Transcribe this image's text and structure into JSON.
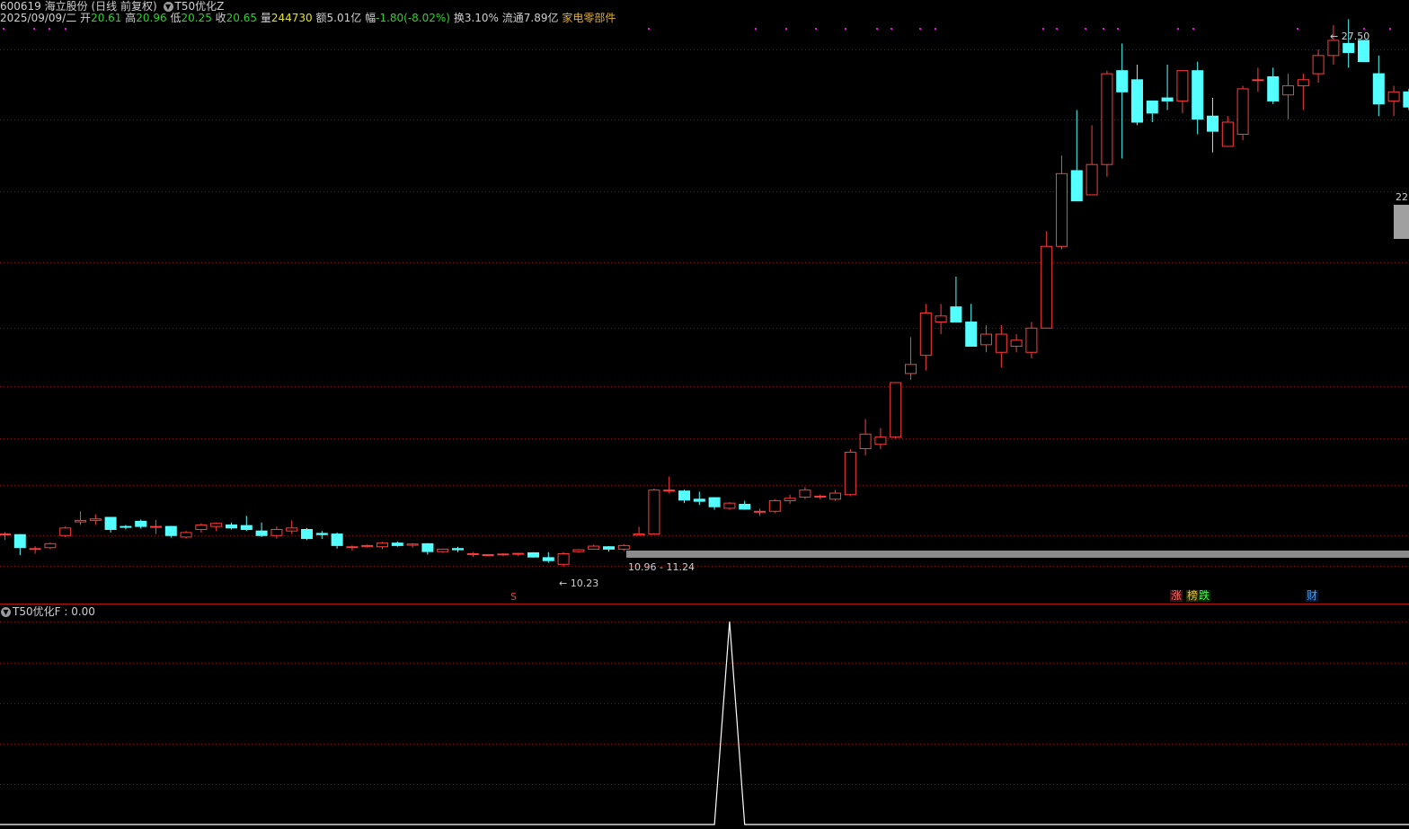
{
  "header": {
    "code": "600619",
    "name": "海立股份",
    "period": "(日线 前复权)",
    "indicator": "T50优化Z",
    "date": "2025/09/09/二",
    "open_label": "开",
    "open": "20.61",
    "high_label": "高",
    "high": "20.96",
    "low_label": "低",
    "low": "20.25",
    "close_label": "收",
    "close": "20.65",
    "vol_label": "量",
    "vol": "244730",
    "amount_label": "额",
    "amount": "5.01亿",
    "change_label": "幅",
    "change": "-1.80(-8.02%)",
    "turnover_label": "换",
    "turnover": "3.10%",
    "float_label": "流通",
    "float": "7.89亿",
    "sector": "家电零部件"
  },
  "annotations": {
    "high_mark": "27.50",
    "low_mark": "10.23",
    "range_label": "10.96 - 11.24",
    "right_price": "22",
    "s_marker": "S",
    "tag_zhang": "涨",
    "tag_bang": "榜",
    "tag_die": "跌",
    "tag_cai": "财"
  },
  "sub_panel": {
    "title": "T50优化F",
    "value_text": ": 0.00"
  },
  "colors": {
    "up": "#ff3c3c",
    "down": "#54ffff",
    "grid": "#7a1414",
    "line": "#ffffff",
    "band": "#8c8c8c",
    "dot": "#ff00ff"
  },
  "chart_data": {
    "type": "candlestick",
    "price_range": [
      9.0,
      28.1
    ],
    "candles": [
      [
        11.0,
        11.06,
        10.8,
        11.0
      ],
      [
        10.98,
        11.0,
        10.3,
        10.55
      ],
      [
        10.5,
        10.6,
        10.35,
        10.52
      ],
      [
        10.55,
        10.72,
        10.5,
        10.68
      ],
      [
        10.95,
        11.25,
        10.9,
        11.2
      ],
      [
        11.4,
        11.75,
        11.3,
        11.45
      ],
      [
        11.45,
        11.65,
        11.3,
        11.5
      ],
      [
        11.55,
        11.56,
        11.05,
        11.15
      ],
      [
        11.25,
        11.3,
        11.15,
        11.23
      ],
      [
        11.42,
        11.48,
        11.18,
        11.25
      ],
      [
        11.25,
        11.46,
        11.0,
        11.25
      ],
      [
        11.25,
        11.27,
        10.88,
        10.95
      ],
      [
        10.9,
        11.1,
        10.85,
        11.05
      ],
      [
        11.15,
        11.35,
        11.05,
        11.3
      ],
      [
        11.25,
        11.38,
        11.1,
        11.35
      ],
      [
        11.3,
        11.38,
        11.15,
        11.2
      ],
      [
        11.28,
        11.6,
        11.1,
        11.15
      ],
      [
        11.1,
        11.38,
        10.9,
        10.95
      ],
      [
        10.95,
        11.25,
        10.85,
        11.15
      ],
      [
        11.1,
        11.45,
        11.0,
        11.2
      ],
      [
        11.15,
        11.2,
        10.8,
        10.85
      ],
      [
        11.02,
        11.1,
        10.84,
        10.98
      ],
      [
        11.0,
        11.05,
        10.52,
        10.62
      ],
      [
        10.55,
        10.62,
        10.45,
        10.58
      ],
      [
        10.6,
        10.65,
        10.55,
        10.62
      ],
      [
        10.58,
        10.74,
        10.5,
        10.7
      ],
      [
        10.7,
        10.75,
        10.58,
        10.62
      ],
      [
        10.63,
        10.7,
        10.55,
        10.67
      ],
      [
        10.68,
        10.7,
        10.32,
        10.42
      ],
      [
        10.42,
        10.52,
        10.38,
        10.5
      ],
      [
        10.52,
        10.58,
        10.4,
        10.48
      ],
      [
        10.35,
        10.4,
        10.25,
        10.35
      ],
      [
        10.3,
        10.34,
        10.26,
        10.32
      ],
      [
        10.32,
        10.36,
        10.28,
        10.34
      ],
      [
        10.34,
        10.38,
        10.28,
        10.36
      ],
      [
        10.38,
        10.4,
        10.22,
        10.24
      ],
      [
        10.22,
        10.4,
        10.05,
        10.12
      ],
      [
        10.0,
        10.4,
        9.92,
        10.35
      ],
      [
        10.42,
        10.5,
        10.38,
        10.48
      ],
      [
        10.5,
        10.65,
        10.48,
        10.6
      ],
      [
        10.58,
        10.6,
        10.42,
        10.5
      ],
      [
        10.5,
        10.66,
        10.44,
        10.62
      ],
      [
        10.96,
        11.24,
        10.96,
        11.0
      ],
      [
        11.0,
        12.5,
        11.0,
        12.45
      ],
      [
        12.45,
        12.9,
        12.35,
        12.45
      ],
      [
        12.42,
        12.46,
        12.02,
        12.12
      ],
      [
        12.15,
        12.4,
        11.96,
        12.08
      ],
      [
        12.2,
        12.22,
        11.8,
        11.9
      ],
      [
        11.85,
        12.05,
        11.8,
        12.02
      ],
      [
        11.98,
        12.1,
        11.8,
        11.82
      ],
      [
        11.72,
        11.84,
        11.6,
        11.75
      ],
      [
        11.75,
        12.15,
        11.7,
        12.1
      ],
      [
        12.1,
        12.3,
        12.0,
        12.18
      ],
      [
        12.22,
        12.55,
        12.15,
        12.45
      ],
      [
        12.25,
        12.3,
        12.15,
        12.25
      ],
      [
        12.15,
        12.45,
        12.1,
        12.35
      ],
      [
        12.3,
        13.8,
        12.25,
        13.7
      ],
      [
        13.82,
        14.8,
        13.6,
        14.3
      ],
      [
        13.96,
        14.5,
        13.8,
        14.2
      ],
      [
        14.2,
        16.0,
        14.15,
        16.0
      ],
      [
        16.3,
        17.5,
        16.1,
        16.6
      ],
      [
        16.9,
        18.6,
        16.4,
        18.3
      ],
      [
        18.0,
        18.6,
        17.6,
        18.2
      ],
      [
        18.5,
        19.5,
        18.0,
        18.0
      ],
      [
        18.0,
        18.6,
        17.5,
        17.2
      ],
      [
        17.25,
        17.9,
        17.0,
        17.6
      ],
      [
        17.0,
        17.9,
        16.5,
        17.6
      ],
      [
        17.2,
        17.6,
        17.0,
        17.4
      ],
      [
        17.0,
        18.0,
        16.8,
        17.8
      ],
      [
        17.8,
        21.0,
        17.8,
        20.5
      ],
      [
        20.5,
        23.5,
        20.4,
        22.9
      ],
      [
        23.0,
        25.0,
        22.2,
        22.0
      ],
      [
        22.2,
        24.5,
        22.2,
        23.2
      ],
      [
        23.2,
        26.3,
        22.8,
        26.2
      ],
      [
        26.3,
        27.2,
        23.4,
        25.6
      ],
      [
        26.0,
        26.5,
        24.5,
        24.6
      ],
      [
        25.3,
        25.3,
        24.6,
        24.9
      ],
      [
        25.4,
        26.5,
        25.0,
        25.3
      ],
      [
        25.3,
        26.2,
        24.9,
        26.3
      ],
      [
        26.3,
        26.6,
        24.2,
        24.7
      ],
      [
        24.8,
        25.4,
        23.6,
        24.3
      ],
      [
        23.8,
        24.8,
        23.8,
        24.6
      ],
      [
        24.2,
        25.8,
        24.0,
        25.7
      ],
      [
        26.0,
        26.4,
        25.6,
        26.0
      ],
      [
        26.1,
        26.4,
        25.2,
        25.3
      ],
      [
        25.5,
        26.2,
        24.7,
        25.8
      ],
      [
        25.8,
        26.2,
        25.0,
        26.0
      ],
      [
        26.2,
        27.0,
        25.9,
        26.8
      ],
      [
        26.8,
        27.8,
        26.5,
        27.3
      ],
      [
        27.2,
        28.0,
        26.4,
        26.9
      ],
      [
        27.3,
        27.3,
        26.6,
        26.6
      ],
      [
        26.2,
        26.8,
        24.8,
        25.2
      ],
      [
        25.3,
        25.8,
        24.8,
        25.6
      ],
      [
        25.6,
        25.7,
        25.0,
        25.1
      ],
      [
        25.0,
        25.0,
        24.5,
        24.6
      ]
    ],
    "sub_series": [
      0,
      0,
      0,
      0,
      0,
      0,
      0,
      0,
      0,
      0,
      0,
      0,
      0,
      0,
      0,
      0,
      0,
      0,
      0,
      0,
      0,
      0,
      0,
      0,
      0,
      0,
      0,
      0,
      0,
      0,
      0,
      0,
      0,
      0,
      0,
      0,
      0,
      0,
      0,
      0,
      0,
      0,
      0,
      0,
      0,
      0,
      0,
      0,
      1,
      0,
      0,
      0,
      0,
      0,
      0,
      0,
      0,
      0,
      0,
      0,
      0,
      0,
      0,
      0,
      0,
      0,
      0,
      0,
      0,
      0,
      0,
      0,
      0,
      0,
      0,
      0,
      0,
      0,
      0,
      0,
      0,
      0,
      0,
      0,
      0,
      0,
      0,
      0,
      0,
      0,
      0,
      0,
      0,
      0,
      0
    ]
  }
}
